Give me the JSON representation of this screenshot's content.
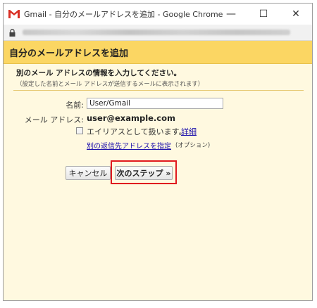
{
  "window": {
    "title": "Gmail - 自分のメールアドレスを追加 - Google Chrome",
    "minimize_glyph": "—",
    "maximize_glyph": "☐",
    "close_glyph": "✕",
    "icon": "gmail-icon",
    "address_icon": "lock-icon"
  },
  "dialog": {
    "header_title": "自分のメールアドレスを追加",
    "intro_title": "別のメール アドレスの情報を入力してください。",
    "intro_sub": "（設定した名前とメール アドレスが送信するメールに表示されます）",
    "name_label": "名前:",
    "name_value": "User/Gmail",
    "email_label": "メール アドレス:",
    "email_value": "user@example.com",
    "alias_label": "エイリアスとして扱います。",
    "alias_checked": false,
    "details_link": "詳細",
    "reply_link": "別の返信先アドレスを指定",
    "optional_note": "(オプション)",
    "cancel_label": "キャンセル",
    "next_label": "次のステップ »"
  },
  "colors": {
    "header_bg": "#fbd663",
    "content_bg": "#fff9e0",
    "highlight": "#e0191e",
    "link": "#1a0dab"
  }
}
